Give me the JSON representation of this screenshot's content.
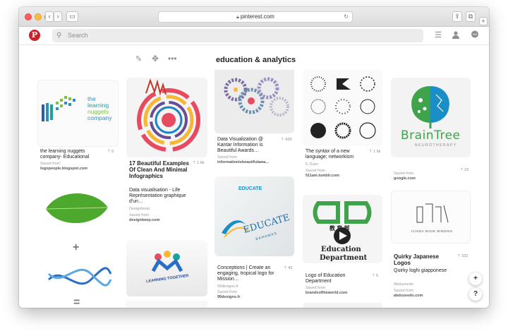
{
  "browser": {
    "url": "pinterest.com"
  },
  "header": {
    "logo": "P",
    "search_placeholder": "Search"
  },
  "board": {
    "heading": "education & analytics"
  },
  "pins": {
    "learning": {
      "logo_line1": "the",
      "logo_line2": "learning",
      "logo_line3": "nuggets",
      "logo_line4": "company",
      "title": "the learning nuggets company- Educational",
      "count": "5",
      "saved_from": "Saved from",
      "source": "logopeople.blogspot.com"
    },
    "leaf": {
      "plus": "+",
      "equals": "="
    },
    "infographic": {
      "title": "17 Beautiful Examples Of Clean And Minimal Infographics",
      "count": "1.6k",
      "desc": "Data visualisation - Life Représentation graphique d'un…",
      "author": "Designbeep",
      "saved_from": "Saved from",
      "source": "designbeep.com"
    },
    "learning_together": {
      "label": "LEARNING TOGETHER"
    },
    "dataviz": {
      "title": "Data Visualization @ Kantar Information is Beautiful Awards…",
      "count": "429",
      "saved_from": "Saved from",
      "source": "informationisbeautifulawa..."
    },
    "educate": {
      "word": "EDUCATE",
      "sub": "BAHAMAS",
      "title": "Conceptions | Create an engaging, tropical logo for Mission…",
      "count": "42",
      "author": "99designs.fr",
      "saved_from": "Saved from",
      "source": "99designs.fr"
    },
    "syntax": {
      "title": "The syntax of a new language; networkism",
      "count": "1.6k",
      "author": "5.11am",
      "saved_from": "Saved from",
      "source": "511am.tumblr.com"
    },
    "edu_dept": {
      "cn": "教 育 部",
      "line1": "Education",
      "line2": "Department",
      "title": "Logo of Education Department",
      "count": "5",
      "saved_from": "Saved from",
      "source": "brandsoftheworld.com"
    },
    "braintree": {
      "word": "BrainTree",
      "sub": "NEUROTHERAPY",
      "count": "22",
      "saved_from": "Saved from",
      "source": "google.com"
    },
    "quirky": {
      "img_label": "ICHIDA BOOK BINDING",
      "title": "Quirky Japanese Logos",
      "count": "332",
      "desc": "Quirky loghi giapponese",
      "author": "Abduzeedo",
      "saved_from": "Saved from",
      "source": "abduzeedo.com"
    }
  },
  "fabs": {
    "add": "+",
    "help": "?"
  },
  "colors": {
    "brand": "#cb2027",
    "teal": "#1aa39a",
    "green": "#3ea34a"
  }
}
